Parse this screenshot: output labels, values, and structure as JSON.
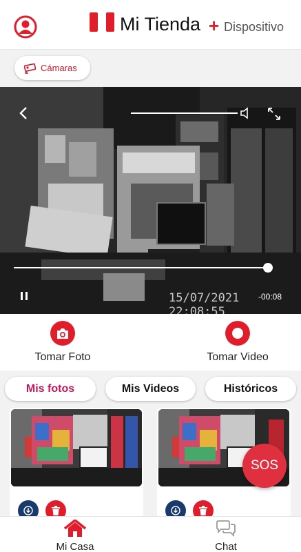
{
  "header": {
    "title": "Mi Tienda",
    "plus": "+",
    "subtitle": "Dispositivo"
  },
  "camera_chip": {
    "label": "Cámaras"
  },
  "video": {
    "timestamp": "15/07/2021 22:08:55",
    "elapsed": "-00:08",
    "progress": 0.9
  },
  "actions": {
    "photo_label": "Tomar Foto",
    "video_label": "Tomar Video"
  },
  "tabs": [
    {
      "label": "Mis fotos",
      "active": true
    },
    {
      "label": "Mis Videos",
      "active": false
    },
    {
      "label": "Históricos",
      "active": false
    }
  ],
  "sos_label": "SOS",
  "bottom_nav": [
    {
      "label": "Mi Casa",
      "icon": "home-icon",
      "active": true
    },
    {
      "label": "Chat",
      "icon": "chat-icon",
      "active": false
    }
  ],
  "colors": {
    "accent": "#e11d2c",
    "active_tab": "#c2185b",
    "download": "#1a3a6e"
  }
}
